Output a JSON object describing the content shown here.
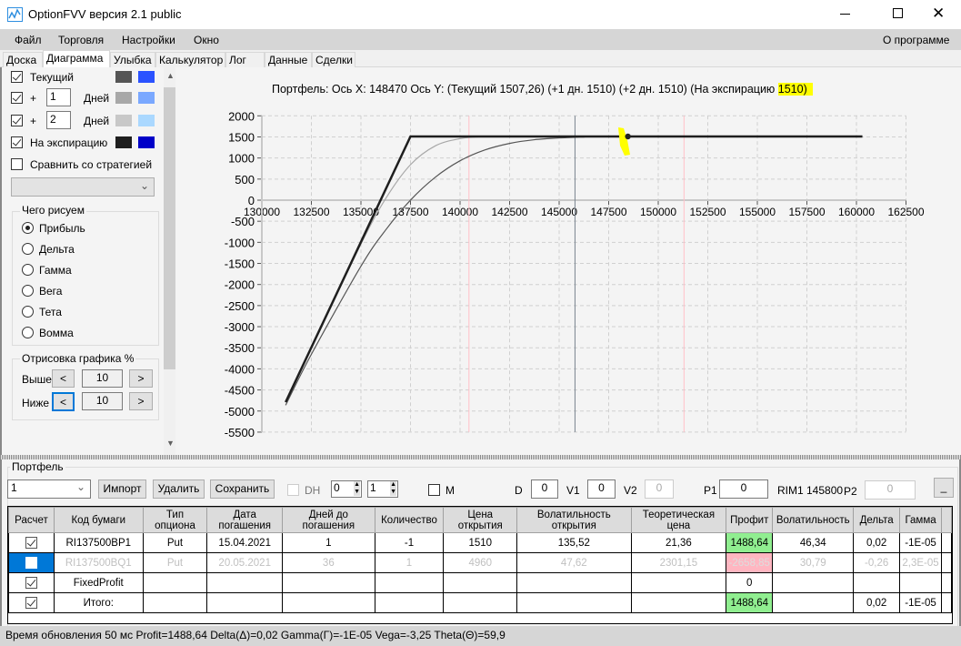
{
  "window": {
    "title": "OptionFVV версия 2.1 public",
    "controls": [
      "minimize",
      "maximize",
      "close"
    ]
  },
  "menu": {
    "items": [
      "Файл",
      "Торговля",
      "Настройки",
      "Окно"
    ],
    "about": "О программе"
  },
  "tabs": [
    {
      "label": "Доска"
    },
    {
      "label": "Диаграмма",
      "active": true
    },
    {
      "label": "Улыбка"
    },
    {
      "label": "Калькулятор"
    },
    {
      "label": "Лог"
    },
    {
      "label": "Данные"
    },
    {
      "label": "Сделки"
    }
  ],
  "left": {
    "current": {
      "label": "Текущий",
      "checked": true,
      "colors": [
        "#555555",
        "#2a52ff"
      ]
    },
    "plus1": {
      "prefix": "+",
      "value": "1",
      "unit": "Дней",
      "checked": true,
      "colors": [
        "#a8a8a8",
        "#7aa8ff"
      ]
    },
    "plus2": {
      "prefix": "+",
      "value": "2",
      "unit": "Дней",
      "checked": true,
      "colors": [
        "#c8c8c8",
        "#aad8ff"
      ]
    },
    "expiry": {
      "label": "На экспирацию",
      "checked": true,
      "colors": [
        "#1e1e1e",
        "#0000c8"
      ]
    },
    "compare": {
      "label": "Сравнить со стратегией",
      "checked": false
    },
    "what_title": "Чего рисуем",
    "what_options": [
      "Прибыль",
      "Дельта",
      "Гамма",
      "Вега",
      "Тета",
      "Вомма"
    ],
    "what_selected": "Прибыль",
    "draw_title": "Отрисовка графика %",
    "above": {
      "label": "Выше",
      "value": "10",
      "dec": "<",
      "inc": ">"
    },
    "below": {
      "label": "Ниже",
      "value": "10",
      "dec": "<",
      "inc": ">"
    }
  },
  "chart_header": {
    "prefix": "Портфель: Ось X: 148470 Ось Y:  (Текущий 1507,26)  (+1 дн. 1510)  (+2 дн. 1510)  (На экспирацию ",
    "highlight": "1510)",
    "highlight_color": "#ffff00"
  },
  "chart_data": {
    "type": "line",
    "xlim": [
      130000,
      162500
    ],
    "ylim": [
      -5500,
      2000
    ],
    "xticks": [
      130000,
      132500,
      135000,
      137500,
      140000,
      142500,
      145000,
      147500,
      150000,
      152500,
      155000,
      157500,
      160000,
      162500
    ],
    "yticks": [
      2000,
      1500,
      1000,
      500,
      0,
      -500,
      -1000,
      -1500,
      -2000,
      -2500,
      -3000,
      -3500,
      -4000,
      -4500,
      -5000,
      -5500
    ],
    "grid": true,
    "vertical_lines": [
      {
        "x": 140450,
        "color": "#ffc0c8"
      },
      {
        "x": 145800,
        "color": "#7a8590"
      },
      {
        "x": 151300,
        "color": "#ffc0c8"
      }
    ],
    "series": [
      {
        "name": "Текущий",
        "color": "#555555",
        "points": [
          [
            131200,
            -4863
          ],
          [
            132500,
            -3654
          ],
          [
            135000,
            -1566
          ],
          [
            136250,
            -705
          ],
          [
            137500,
            2
          ],
          [
            138750,
            544
          ],
          [
            140000,
            934
          ],
          [
            141250,
            1190
          ],
          [
            142500,
            1346
          ],
          [
            143750,
            1433
          ],
          [
            145000,
            1476
          ],
          [
            146300,
            1500
          ]
        ]
      },
      {
        "name": "+1 дн.",
        "color": "#a8a8a8",
        "points": [
          [
            131200,
            -4790
          ],
          [
            132500,
            -3491
          ],
          [
            135000,
            -1041
          ],
          [
            136250,
            38
          ],
          [
            137500,
            841
          ],
          [
            138750,
            1288
          ],
          [
            140000,
            1459
          ],
          [
            141000,
            1505
          ]
        ]
      },
      {
        "name": "На экспирацию",
        "color": "#1e1e1e",
        "points": [
          [
            131200,
            -4790
          ],
          [
            137500,
            1510
          ],
          [
            160300,
            1510
          ]
        ]
      }
    ],
    "marker": {
      "x": 148470,
      "y": 1510
    }
  },
  "portfolio": {
    "title": "Портфель",
    "select": "1",
    "import": "Импорт",
    "delete": "Удалить",
    "save": "Сохранить",
    "dh": "DH",
    "spin1": "0",
    "spin2": "1",
    "m": "M",
    "d_label": "D",
    "d": "0",
    "v1_label": "V1",
    "v1": "0",
    "v2_label": "V2",
    "v2": "0",
    "p1_label": "P1",
    "p1": "0",
    "ticker": "RIM1 145800",
    "p2_label": "P2",
    "p2": "0",
    "min_btn": "_",
    "columns": [
      "Расчет",
      "Код бумаги",
      "Тип опциона",
      "Дата погашения",
      "Дней до погашения",
      "Количество",
      "Цена открытия",
      "Волатильность открытия",
      "Теоретическая цена",
      "Профит",
      "Волатильность",
      "Дельта",
      "Гамма"
    ],
    "rows": [
      {
        "checked": true,
        "cells": [
          "RI137500BP1",
          "Put",
          "15.04.2021",
          "1",
          "-1",
          "1510",
          "135,52",
          "21,36",
          "1488,64",
          "46,34",
          "0,02",
          "-1E-05"
        ],
        "profit": "pos"
      },
      {
        "checked": false,
        "disabled": true,
        "cells": [
          "RI137500BQ1",
          "Put",
          "20.05.2021",
          "36",
          "1",
          "4960",
          "47,62",
          "2301,15",
          "-2658,85",
          "30,79",
          "-0,26",
          "2,3E-05"
        ],
        "profit": "neg"
      },
      {
        "checked": true,
        "cells": [
          "FixedProfit",
          "",
          "",
          "",
          "",
          "",
          "",
          "",
          "0",
          "",
          "",
          ""
        ]
      },
      {
        "checked": true,
        "cells": [
          "Итого:",
          "",
          "",
          "",
          "",
          "",
          "",
          "",
          "1488,64",
          "",
          "0,02",
          "-1E-05"
        ],
        "profit": "pos"
      }
    ]
  },
  "status": "Время обновления 50 мс  Profit=1488,64 Delta(Δ)=0,02 Gamma(Γ)=-1E-05 Vega=-3,25 Theta(Θ)=59,9"
}
